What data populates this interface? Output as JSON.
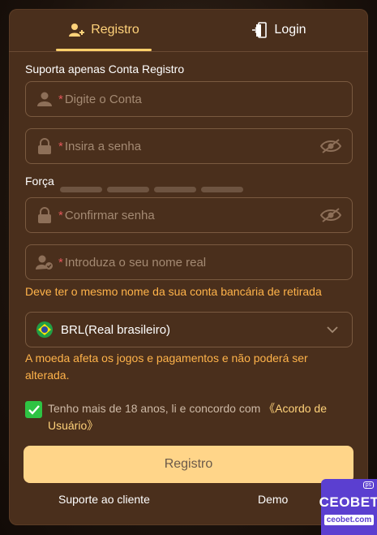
{
  "tabs": {
    "register": "Registro",
    "login": "Login"
  },
  "form": {
    "account_label": "Suporta apenas Conta Registro",
    "required_mark": "*",
    "account_placeholder": "Digite o Conta",
    "password_placeholder": "Insira a senha",
    "strength_label": "Força",
    "confirm_placeholder": "Confirmar senha",
    "realname_placeholder": "Introduza o seu nome real",
    "realname_hint": "Deve ter o mesmo nome da sua conta bancária de retirada",
    "currency_value": "BRL(Real brasileiro)",
    "currency_hint": "A moeda afeta os jogos e pagamentos e não poderá ser alterada.",
    "agree_text": "Tenho mais de 18 anos, li e concordo com",
    "agree_link": "《Acordo de Usuário》",
    "agree_checked": true,
    "submit_label": "Registro"
  },
  "footer": {
    "support": "Suporte ao cliente",
    "demo": "Demo"
  },
  "badge": {
    "brand": "CEOBET",
    "site": "ceobet.com",
    "tag": "ps"
  },
  "colors": {
    "accent": "#ffcf6a",
    "panel": "#4a2f1c",
    "warning": "#ffb34a",
    "check": "#2ec343",
    "submit": "#ffd589"
  }
}
